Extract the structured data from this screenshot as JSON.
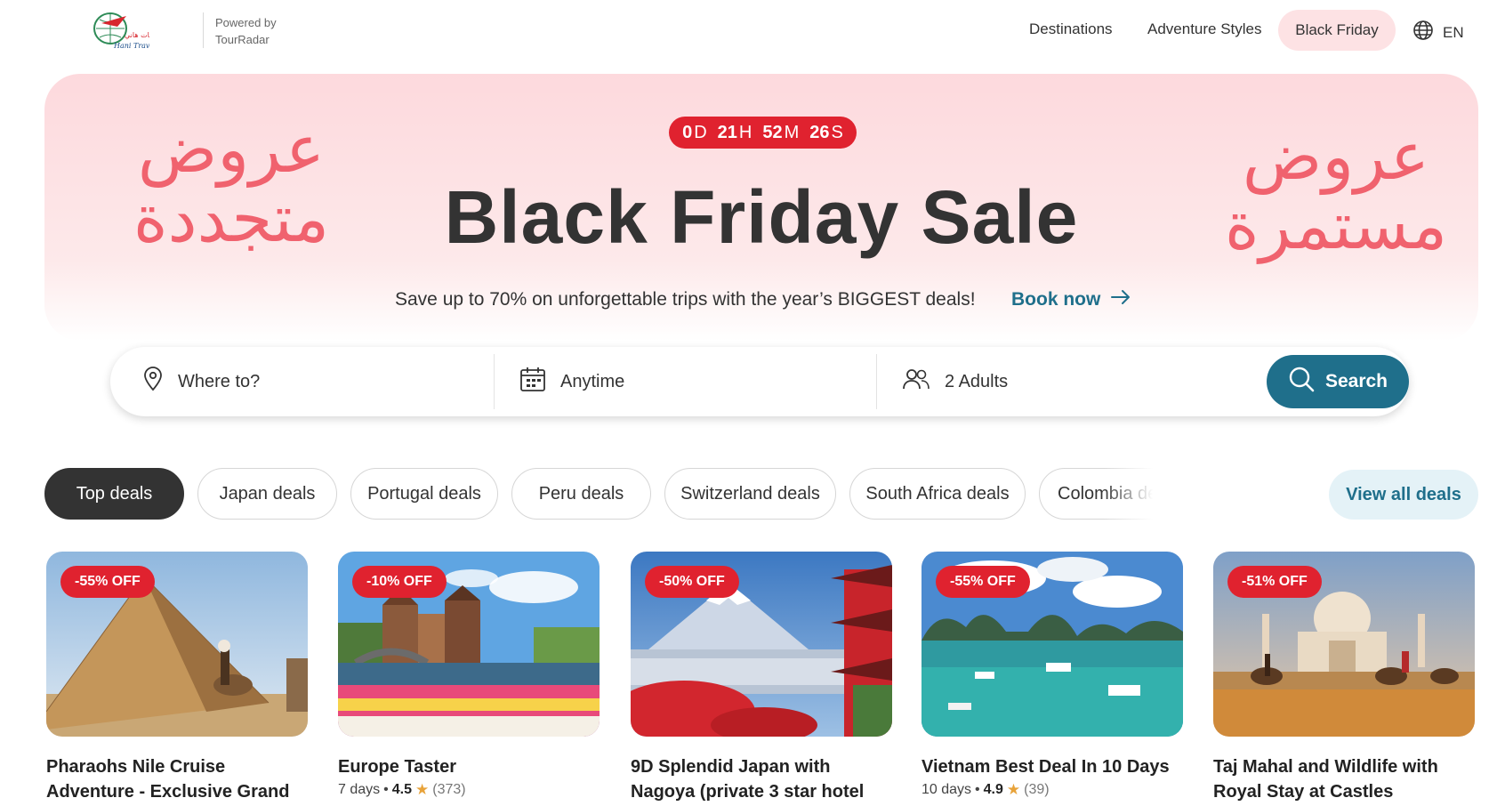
{
  "header": {
    "logo_text": "Hani Travel",
    "powered_by_line1": "Powered by",
    "powered_by_line2": "TourRadar",
    "nav": [
      "Destinations",
      "Adventure Styles",
      "Black Friday"
    ],
    "language": "EN",
    "language_icon": "globe-icon"
  },
  "hero": {
    "countdown": {
      "days": "0",
      "hours": "21",
      "minutes": "52",
      "seconds": "26",
      "d_unit": "D",
      "h_unit": "H",
      "m_unit": "M",
      "s_unit": "S"
    },
    "title": "Black Friday Sale",
    "subtitle": "Save up to 70% on unforgettable trips with the year’s BIGGEST deals!",
    "cta": "Book now",
    "arabic_left": "عروض متجددة",
    "arabic_right": "عروض مستمرة",
    "accent_color": "#e0222f",
    "background_color": "#fdd9dd"
  },
  "search": {
    "destination_placeholder": "Where to?",
    "date_value": "Anytime",
    "travelers_value": "2 Adults",
    "button_label": "Search",
    "button_color": "#1f6f8b"
  },
  "filters": {
    "pills": [
      "Top deals",
      "Japan deals",
      "Portugal deals",
      "Peru deals",
      "Switzerland deals",
      "South Africa deals",
      "Colombia deals"
    ],
    "active_index": 0,
    "view_all": "View all deals"
  },
  "deals": [
    {
      "badge": "-55% OFF",
      "title": "Pharaohs Nile Cruise Adventure - Exclusive Grand",
      "days": "",
      "rating": "",
      "reviews": "",
      "image": "pyramid-camel"
    },
    {
      "badge": "-10% OFF",
      "title": "Europe Taster",
      "days": "7 days",
      "rating": "4.5",
      "reviews": "(373)",
      "image": "amsterdam-tulips"
    },
    {
      "badge": "-50% OFF",
      "title": "9D Splendid Japan with Nagoya (private 3 star hotel",
      "days": "",
      "rating": "",
      "reviews": "",
      "image": "mount-fuji-pagoda"
    },
    {
      "badge": "-55% OFF",
      "title": "Vietnam Best Deal In 10 Days",
      "days": "10 days",
      "rating": "4.9",
      "reviews": "(39)",
      "image": "halong-bay"
    },
    {
      "badge": "-51% OFF",
      "title": "Taj Mahal and Wildlife with Royal Stay at Castles",
      "days": "",
      "rating": "",
      "reviews": "",
      "image": "taj-mahal-camels"
    }
  ]
}
